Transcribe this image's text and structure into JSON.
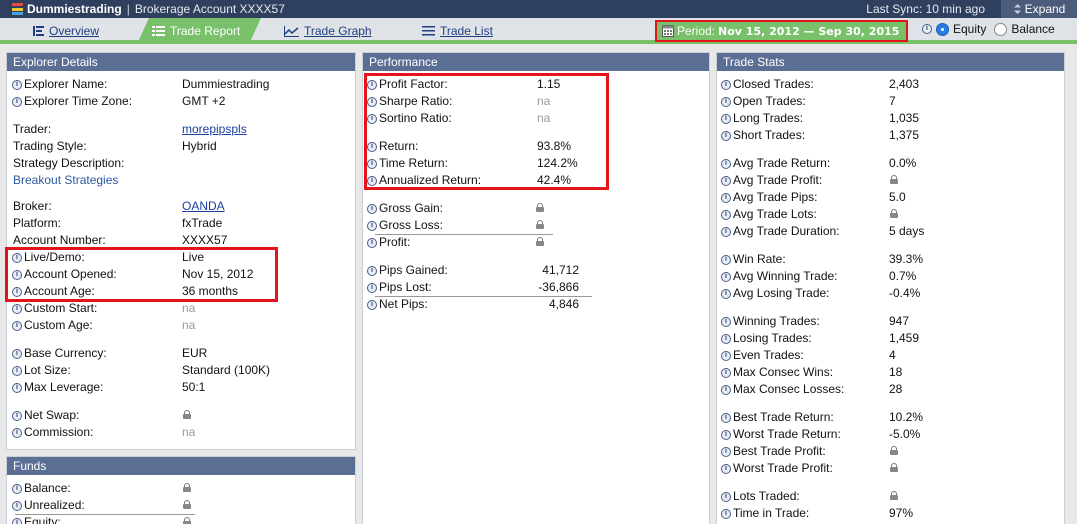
{
  "header": {
    "brand": "Dummiestrading",
    "separator": "|",
    "account": "Brokerage Account XXXX57",
    "sync": "Last Sync: 10 min ago",
    "expand": "Expand",
    "logo_colors": [
      "#e94a3d",
      "#f2c531",
      "#4aa3df"
    ]
  },
  "nav": {
    "tabs": [
      {
        "label": "Overview",
        "icon": "list-icon"
      },
      {
        "label": "Trade Report",
        "icon": "report-icon",
        "active": true
      },
      {
        "label": "Trade Graph",
        "icon": "graph-icon"
      },
      {
        "label": "Trade List",
        "icon": "list-lines-icon"
      }
    ],
    "period_label": "Period:",
    "period_value": "Nov 15, 2012 — Sep 30, 2015",
    "radio_equity": "Equity",
    "radio_balance": "Balance",
    "selected": "Equity"
  },
  "colors": {
    "topbar": "#2f3f5e",
    "panel_header": "#5b6e94",
    "accent_green": "#79c06b",
    "highlight_red": "#e3141c"
  },
  "explorer": {
    "title": "Explorer Details",
    "rows": [
      {
        "label": "Explorer Name:",
        "value": "Dummiestrading",
        "info": true
      },
      {
        "label": "Explorer Time Zone:",
        "value": "GMT +2",
        "info": true
      },
      {
        "label": "Trader:",
        "value": "morepipspls",
        "link": true
      },
      {
        "label": "Trading Style:",
        "value": "Hybrid"
      },
      {
        "label": "Strategy Description:",
        "value": ""
      },
      {
        "label": "Breakout Strategies",
        "value": "",
        "plain_link": true
      },
      {
        "label": "Broker:",
        "value": "OANDA",
        "link": true
      },
      {
        "label": "Platform:",
        "value": "fxTrade"
      },
      {
        "label": "Account Number:",
        "value": "XXXX57"
      },
      {
        "label": "Live/Demo:",
        "value": "Live",
        "info": true
      },
      {
        "label": "Account Opened:",
        "value": "Nov 15, 2012",
        "info": true
      },
      {
        "label": "Account Age:",
        "value": "36 months",
        "info": true
      },
      {
        "label": "Custom Start:",
        "value": "na",
        "info": true,
        "na": true
      },
      {
        "label": "Custom Age:",
        "value": "na",
        "info": true,
        "na": true
      },
      {
        "label": "Base Currency:",
        "value": "EUR",
        "info": true
      },
      {
        "label": "Lot Size:",
        "value": "Standard (100K)",
        "info": true
      },
      {
        "label": "Max Leverage:",
        "value": "50:1",
        "info": true
      },
      {
        "label": "Net Swap:",
        "value": "",
        "info": true,
        "lock": true
      },
      {
        "label": "Commission:",
        "value": "na",
        "info": true,
        "na": true
      }
    ]
  },
  "funds": {
    "title": "Funds",
    "rows": [
      {
        "label": "Balance:",
        "value": "",
        "info": true,
        "lock": true
      },
      {
        "label": "Unrealized:",
        "value": "",
        "info": true,
        "lock": true
      },
      {
        "label": "Equity:",
        "value": "",
        "info": true,
        "lock": true
      }
    ]
  },
  "performance": {
    "title": "Performance",
    "rows": [
      {
        "label": "Profit Factor:",
        "value": "1.15"
      },
      {
        "label": "Sharpe Ratio:",
        "value": "na",
        "na": true
      },
      {
        "label": "Sortino Ratio:",
        "value": "na",
        "na": true
      },
      {
        "label": "Return:",
        "value": "93.8%"
      },
      {
        "label": "Time Return:",
        "value": "124.2%"
      },
      {
        "label": "Annualized Return:",
        "value": "42.4%"
      },
      {
        "label": "Gross Gain:",
        "value": "",
        "lock": true
      },
      {
        "label": "Gross Loss:",
        "value": "",
        "lock": true
      },
      {
        "label": "Profit:",
        "value": "",
        "lock": true
      },
      {
        "label": "Pips Gained:",
        "value": "41,712"
      },
      {
        "label": "Pips Lost:",
        "value": "-36,866"
      },
      {
        "label": "Net Pips:",
        "value": "4,846"
      }
    ]
  },
  "stats": {
    "title": "Trade Stats",
    "rows": [
      {
        "label": "Closed Trades:",
        "value": "2,403"
      },
      {
        "label": "Open Trades:",
        "value": "7"
      },
      {
        "label": "Long Trades:",
        "value": "1,035"
      },
      {
        "label": "Short Trades:",
        "value": "1,375"
      },
      {
        "label": "Avg Trade Return:",
        "value": "0.0%"
      },
      {
        "label": "Avg Trade Profit:",
        "value": "",
        "lock": true
      },
      {
        "label": "Avg Trade Pips:",
        "value": "5.0"
      },
      {
        "label": "Avg Trade Lots:",
        "value": "",
        "lock": true
      },
      {
        "label": "Avg Trade Duration:",
        "value": "5 days"
      },
      {
        "label": "Win Rate:",
        "value": "39.3%"
      },
      {
        "label": "Avg Winning Trade:",
        "value": "0.7%"
      },
      {
        "label": "Avg Losing Trade:",
        "value": "-0.4%"
      },
      {
        "label": "Winning Trades:",
        "value": "947"
      },
      {
        "label": "Losing Trades:",
        "value": "1,459"
      },
      {
        "label": "Even Trades:",
        "value": "4"
      },
      {
        "label": "Max Consec Wins:",
        "value": "18"
      },
      {
        "label": "Max Consec Losses:",
        "value": "28"
      },
      {
        "label": "Best Trade Return:",
        "value": "10.2%"
      },
      {
        "label": "Worst Trade Return:",
        "value": "-5.0%"
      },
      {
        "label": "Best Trade Profit:",
        "value": "",
        "lock": true
      },
      {
        "label": "Worst Trade Profit:",
        "value": "",
        "lock": true
      },
      {
        "label": "Lots Traded:",
        "value": "",
        "lock": true
      },
      {
        "label": "Time in Trade:",
        "value": "97%"
      }
    ]
  }
}
